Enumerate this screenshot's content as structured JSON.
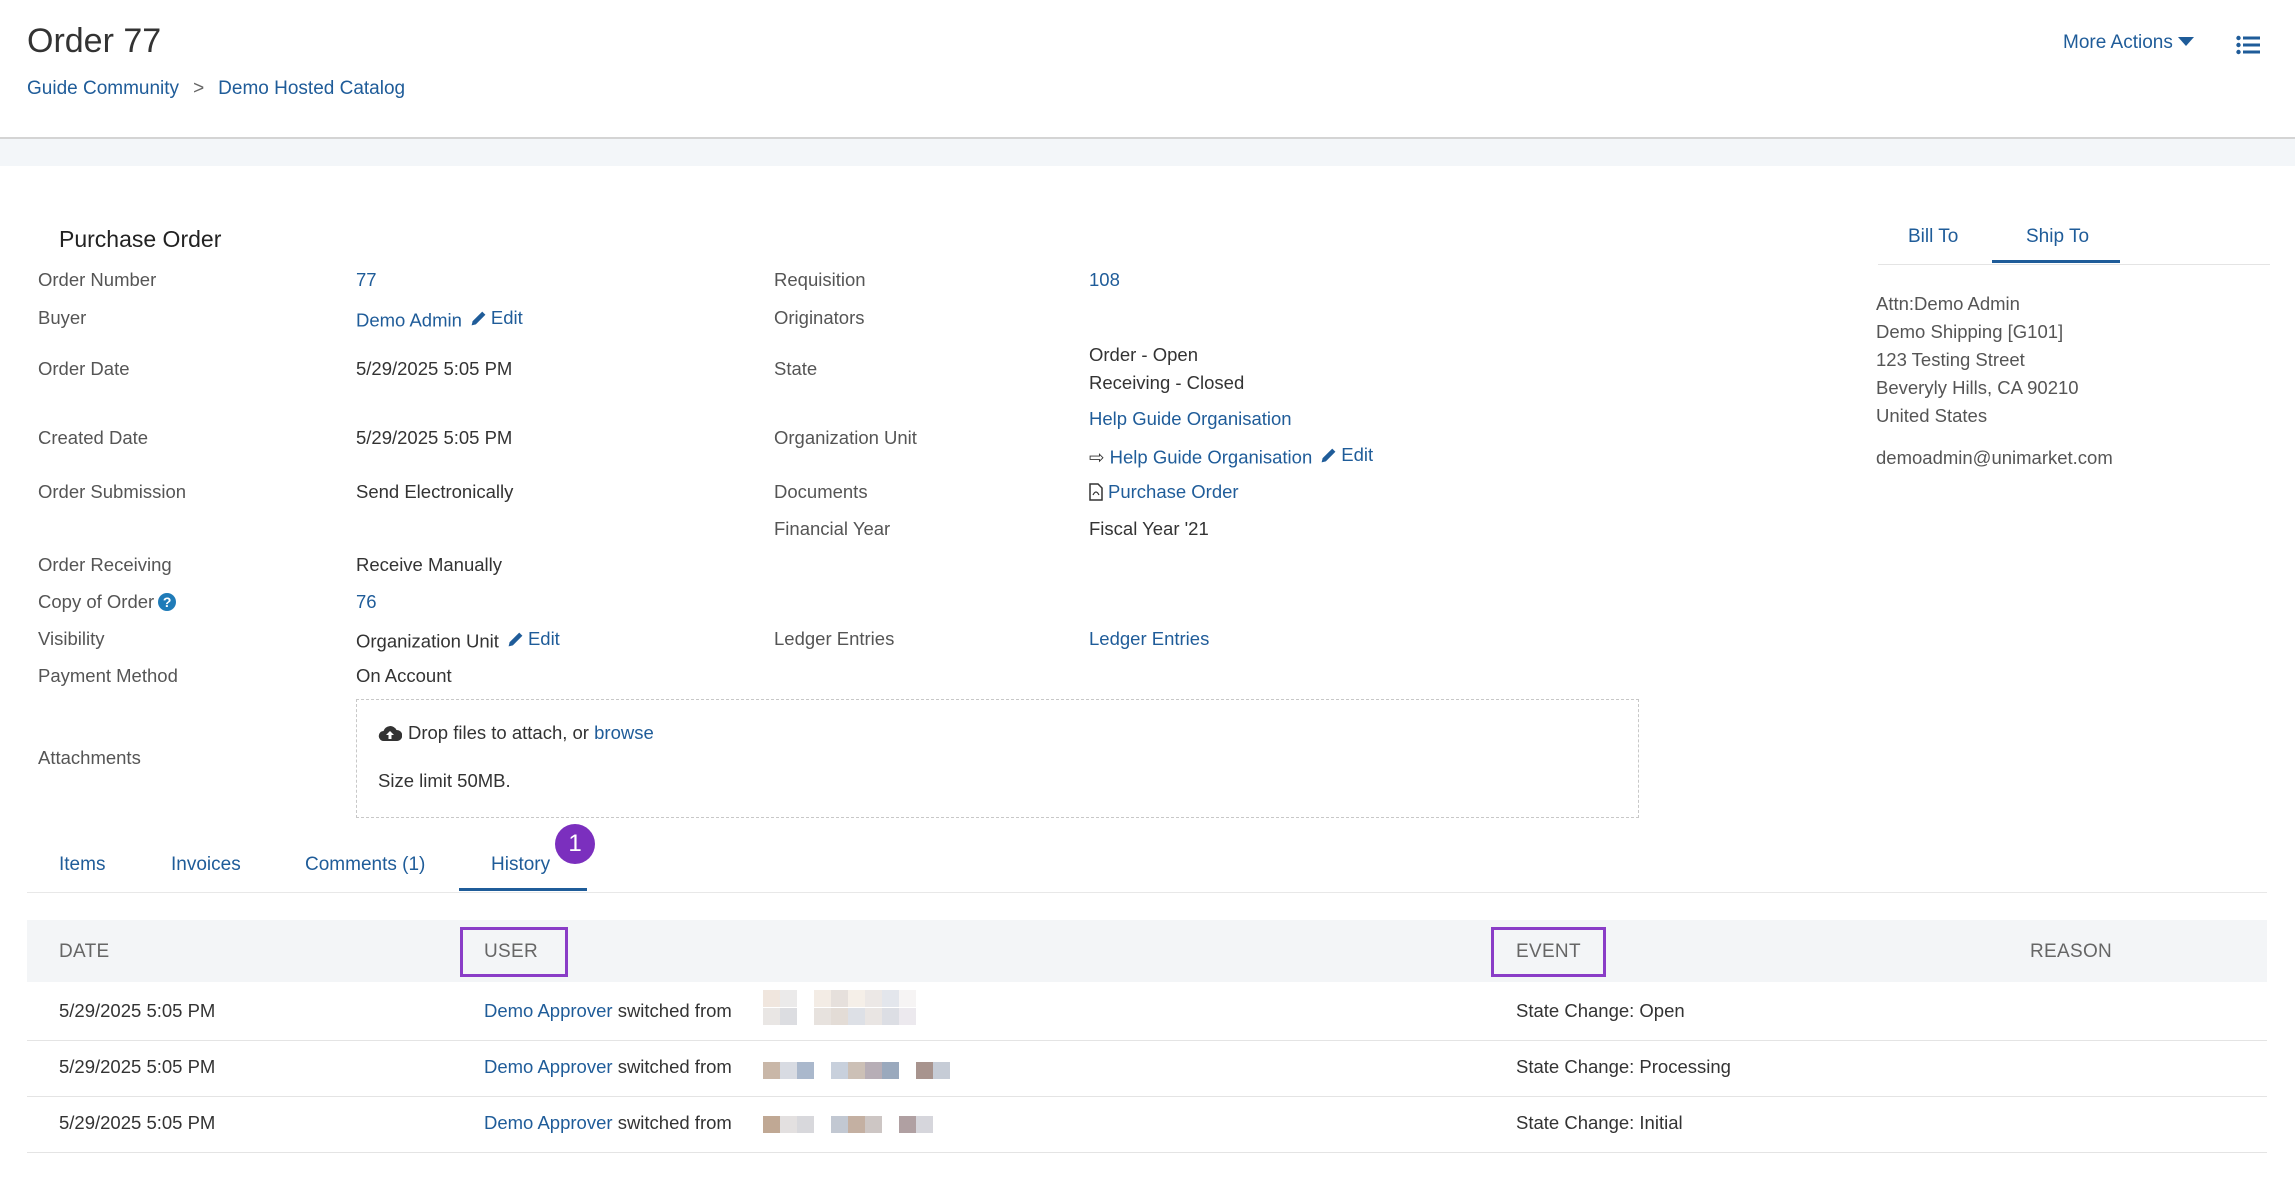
{
  "header": {
    "title": "Order 77",
    "breadcrumb": [
      "Guide Community",
      "Demo Hosted Catalog"
    ],
    "breadcrumb_separator": ">",
    "more_actions_label": "More Actions"
  },
  "details": {
    "section_title": "Purchase Order",
    "order_number": {
      "label": "Order Number",
      "value": "77"
    },
    "buyer": {
      "label": "Buyer",
      "value": "Demo Admin",
      "edit_label": "Edit"
    },
    "order_date": {
      "label": "Order Date",
      "value": "5/29/2025 5:05 PM"
    },
    "created_date": {
      "label": "Created Date",
      "value": "5/29/2025 5:05 PM"
    },
    "order_submission": {
      "label": "Order Submission",
      "value": "Send Electronically"
    },
    "order_receiving": {
      "label": "Order Receiving",
      "value": "Receive Manually"
    },
    "copy_of_order": {
      "label": "Copy of Order",
      "value": "76",
      "help_icon": "?"
    },
    "visibility": {
      "label": "Visibility",
      "value": "Organization Unit",
      "edit_label": "Edit"
    },
    "payment_method": {
      "label": "Payment Method",
      "value": "On Account"
    },
    "attachments": {
      "label": "Attachments",
      "drop_text": "Drop files to attach, or",
      "browse_label": "browse",
      "size_limit": "Size limit 50MB."
    },
    "requisition": {
      "label": "Requisition",
      "value": "108"
    },
    "originators": {
      "label": "Originators",
      "value": ""
    },
    "state": {
      "label": "State",
      "order_state": "Order - Open",
      "receiving_state": "Receiving - Closed"
    },
    "organization_unit": {
      "label": "Organization Unit",
      "primary": "Help Guide Organisation",
      "arrow": "⇨",
      "secondary": "Help Guide Organisation",
      "edit_label": "Edit"
    },
    "documents": {
      "label": "Documents",
      "value": "Purchase Order"
    },
    "financial_year": {
      "label": "Financial Year",
      "value": "Fiscal Year '21"
    },
    "ledger_entries": {
      "label": "Ledger Entries",
      "value": "Ledger Entries"
    }
  },
  "address": {
    "tabs": [
      {
        "label": "Bill To",
        "active": false
      },
      {
        "label": "Ship To",
        "active": true
      }
    ],
    "lines": [
      "Attn:Demo Admin",
      "Demo Shipping [G101]",
      "123 Testing Street",
      "Beveryly Hills, CA 90210",
      "United States"
    ],
    "email": "demoadmin@unimarket.com"
  },
  "lower_tabs": [
    {
      "label": "Items",
      "active": false
    },
    {
      "label": "Invoices",
      "active": false
    },
    {
      "label": "Comments (1)",
      "active": false
    },
    {
      "label": "History",
      "active": true
    }
  ],
  "step_badge": "1",
  "history": {
    "columns": [
      "DATE",
      "USER",
      "EVENT",
      "REASON"
    ],
    "rows": [
      {
        "date": "5/29/2025 5:05 PM",
        "user": "Demo Approver",
        "action": "switched from",
        "event": "State Change: Open",
        "reason": ""
      },
      {
        "date": "5/29/2025 5:05 PM",
        "user": "Demo Approver",
        "action": "switched from",
        "event": "State Change: Processing",
        "reason": ""
      },
      {
        "date": "5/29/2025 5:05 PM",
        "user": "Demo Approver",
        "action": "switched from",
        "event": "State Change: Initial",
        "reason": ""
      }
    ]
  },
  "colors": {
    "link": "#1f5c99",
    "highlight": "#8a3dc7",
    "badge": "#7b2fbe",
    "table_header_bg": "#f3f5f7"
  }
}
